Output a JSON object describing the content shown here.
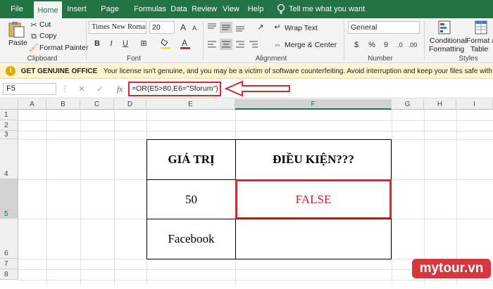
{
  "ribbon_tabs": [
    "File",
    "Home",
    "Insert",
    "Page Layout",
    "Formulas",
    "Data",
    "Review",
    "View",
    "Help"
  ],
  "tell_me": "Tell me what you want to do",
  "clipboard": {
    "paste": "Paste",
    "cut": "Cut",
    "copy": "Copy",
    "format_painter": "Format Painter",
    "label": "Clipboard"
  },
  "font": {
    "name": "Times New Roman",
    "size": "20",
    "bold": "B",
    "italic": "I",
    "underline": "U",
    "label": "Font"
  },
  "alignment": {
    "wrap_text": "Wrap Text",
    "merge_center": "Merge & Center",
    "label": "Alignment"
  },
  "number": {
    "format": "General",
    "percent": "%",
    "comma": "9",
    "label": "Number"
  },
  "styles": {
    "conditional": "Conditional",
    "formatting": "Formatting",
    "format_as": "Format as",
    "table": "Table",
    "label": "Styles"
  },
  "message_bar": {
    "title": "GET GENUINE OFFICE",
    "text": "Your license isn't genuine, and you may be a victim of software counterfeiting. Avoid interruption and keep your files safe with genuine Office today."
  },
  "formula_bar": {
    "name_box": "F5",
    "fx": "fx",
    "formula": "=OR(E5>80,E6=\"Sforum\")"
  },
  "columns": [
    "A",
    "B",
    "C",
    "D",
    "E",
    "F",
    "G",
    "H",
    "I"
  ],
  "rows": [
    "1",
    "2",
    "3",
    "4",
    "5",
    "6",
    "7",
    "8"
  ],
  "table": {
    "header_e": "GIÁ TRỊ",
    "header_f": "ĐIỀU KIỆN???",
    "e5": "50",
    "f5": "FALSE",
    "e6": "Facebook",
    "f6": ""
  },
  "watermark": "mytour.vn",
  "colors": {
    "excel_green": "#217346",
    "highlight_red": "#d22b2b",
    "false_text": "#c0272d"
  }
}
